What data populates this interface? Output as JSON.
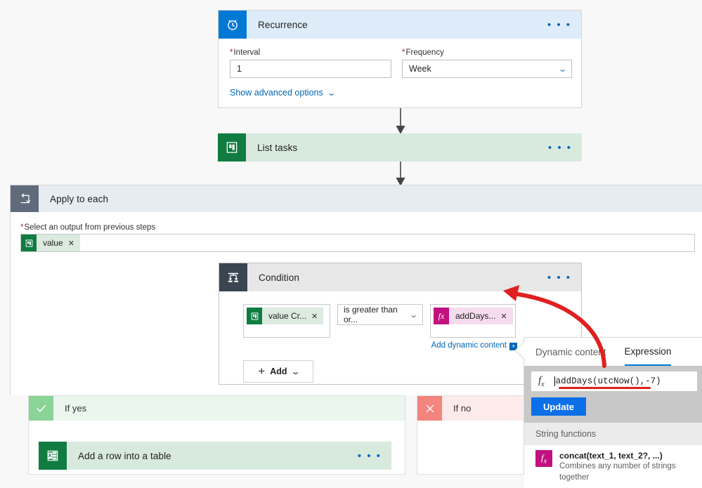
{
  "flow": {
    "recurrence": {
      "title": "Recurrence",
      "icon": "alarm-clock-icon",
      "interval": {
        "label": "Interval",
        "required": true,
        "value": "1"
      },
      "frequency": {
        "label": "Frequency",
        "required": true,
        "value": "Week"
      },
      "advanced_link": "Show advanced options",
      "menu": "• • •"
    },
    "list_tasks": {
      "title": "List tasks",
      "icon": "planner-icon",
      "menu": "• • •"
    },
    "apply_to_each": {
      "title": "Apply to each",
      "icon": "loop-icon",
      "output_label": "Select an output from previous steps",
      "output_required": true,
      "token": {
        "text": "value",
        "icon": "planner-icon",
        "remove": "✕"
      }
    },
    "condition": {
      "title": "Condition",
      "icon": "condition-icon",
      "menu": "• • •",
      "left_token": {
        "text": "value Cr...",
        "icon": "planner-icon",
        "remove": "✕"
      },
      "operator": {
        "value": "is greater than or...",
        "chevron": "⌄"
      },
      "right_token": {
        "text": "addDays...",
        "icon": "fx-icon",
        "remove": "✕"
      },
      "add_dynamic_content": "Add dynamic content",
      "add_dynamic_plus": "+",
      "add_button": {
        "label": "Add",
        "plus": "+",
        "chevron": "⌄"
      }
    },
    "if_yes": {
      "title": "If yes",
      "icon": "checkmark-icon",
      "action": {
        "title": "Add a row into a table",
        "icon": "excel-icon",
        "menu": "• • •"
      }
    },
    "if_no": {
      "title": "If no",
      "icon": "close-icon"
    }
  },
  "expression_panel": {
    "tabs": [
      {
        "label": "Dynamic content",
        "active": false
      },
      {
        "label": "Expression",
        "active": true
      }
    ],
    "input": {
      "fx": "fx",
      "value": "addDays(utcNow(),-7)"
    },
    "update_button": "Update",
    "section_header": "String functions",
    "functions": [
      {
        "signature": "concat(text_1, text_2?, ...)",
        "description": "Combines any number of strings together",
        "icon": "fx-icon"
      }
    ]
  },
  "colors": {
    "accent_blue": "#0078d4",
    "planner_green": "#107c41",
    "excel_green": "#107c41",
    "expression_magenta": "#c2117e",
    "loop_slate": "#5f6b7a",
    "condition_slate": "#3b4552",
    "yes_green": "#8ad498",
    "no_red": "#f4847e",
    "annotation_red": "#e02020",
    "update_blue": "#0b6fe8"
  }
}
